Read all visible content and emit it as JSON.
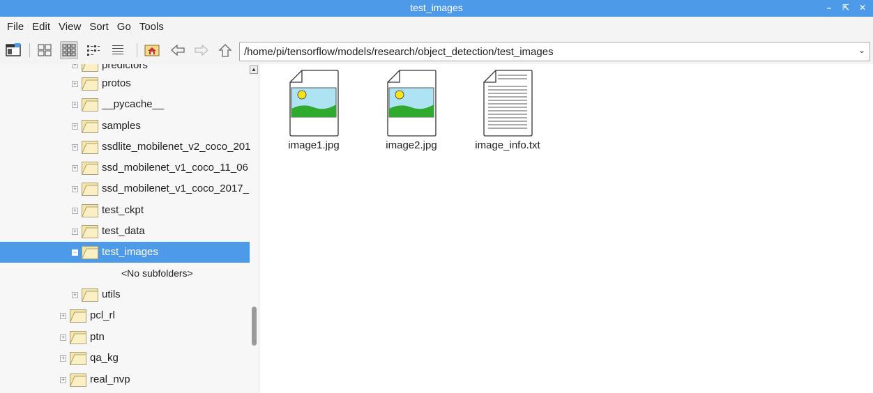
{
  "window": {
    "title": "test_images",
    "minimize": "–",
    "maximize": "⇱",
    "close": "✕"
  },
  "menu": [
    "File",
    "Edit",
    "View",
    "Sort",
    "Go",
    "Tools"
  ],
  "toolbar": {
    "path": "/home/pi/tensorflow/models/research/object_detection/test_images",
    "dropdown": "⌄"
  },
  "tree": {
    "items": [
      {
        "label": "predictors"
      },
      {
        "label": "protos"
      },
      {
        "label": "__pycache__"
      },
      {
        "label": "samples"
      },
      {
        "label": "ssdlite_mobilenet_v2_coco_201"
      },
      {
        "label": "ssd_mobilenet_v1_coco_11_06"
      },
      {
        "label": "ssd_mobilenet_v1_coco_2017_"
      },
      {
        "label": "test_ckpt"
      },
      {
        "label": "test_data"
      },
      {
        "label": "test_images"
      },
      {
        "label": "utils"
      },
      {
        "label": "pcl_rl"
      },
      {
        "label": "ptn"
      },
      {
        "label": "qa_kg"
      },
      {
        "label": "real_nvp"
      }
    ],
    "no_subfolders": "<No subfolders>",
    "selected": "test_images"
  },
  "files": [
    {
      "name": "image1.jpg",
      "icon": "image-file-icon"
    },
    {
      "name": "image2.jpg",
      "icon": "image-file-icon"
    },
    {
      "name": "image_info.txt",
      "icon": "text-file-icon"
    }
  ],
  "colors": {
    "accent": "#4d9ae8",
    "folder": "#f5e6a6"
  }
}
